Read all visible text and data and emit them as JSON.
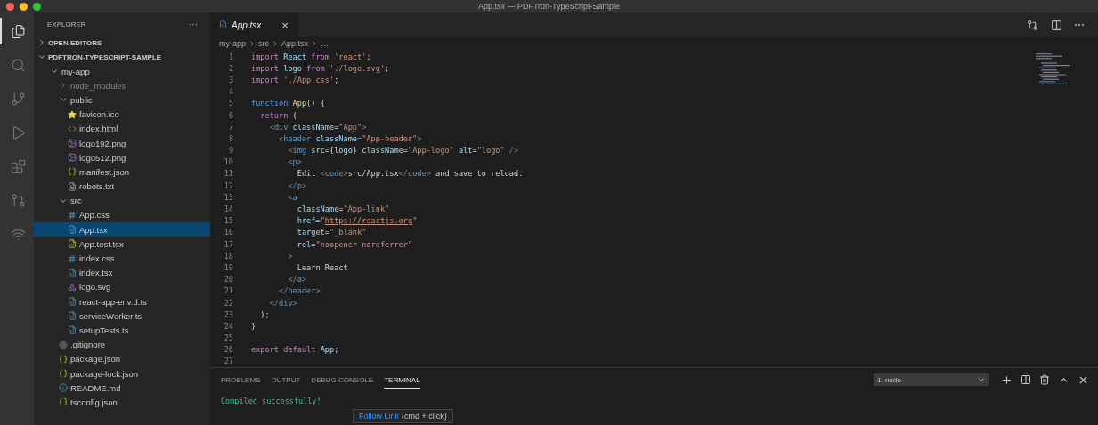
{
  "window": {
    "title": "App.tsx — PDFTron-TypeScript-Sample"
  },
  "activity_bar": [
    {
      "kind": "files",
      "selected": true
    },
    {
      "kind": "search",
      "selected": false
    },
    {
      "kind": "branch",
      "selected": false
    },
    {
      "kind": "debug",
      "selected": false
    },
    {
      "kind": "extensions",
      "selected": false
    },
    {
      "kind": "pull",
      "selected": false
    },
    {
      "kind": "remote",
      "selected": false
    }
  ],
  "sidebar": {
    "title": "EXPLORER",
    "more": "···",
    "sections": [
      {
        "label": "OPEN EDITORS",
        "expanded": false
      },
      {
        "label": "PDFTRON-TYPESCRIPT-SAMPLE",
        "expanded": true
      }
    ],
    "tree": [
      {
        "label": "my-app",
        "kind": "folder",
        "expanded": true,
        "selected": false,
        "children": [
          {
            "label": "node_modules",
            "kind": "folder",
            "expanded": false,
            "selected": false,
            "dim": true
          },
          {
            "label": "public",
            "kind": "folder",
            "expanded": true,
            "selected": false,
            "children": [
              {
                "label": "favicon.ico",
                "kind": "star",
                "selected": false
              },
              {
                "label": "index.html",
                "kind": "html",
                "selected": false
              },
              {
                "label": "logo192.png",
                "kind": "image",
                "selected": false
              },
              {
                "label": "logo512.png",
                "kind": "image",
                "selected": false
              },
              {
                "label": "manifest.json",
                "kind": "json",
                "selected": false
              },
              {
                "label": "robots.txt",
                "kind": "text",
                "selected": false
              }
            ]
          },
          {
            "label": "src",
            "kind": "folder",
            "expanded": true,
            "selected": false,
            "children": [
              {
                "label": "App.css",
                "kind": "css",
                "selected": false
              },
              {
                "label": "App.tsx",
                "kind": "ts",
                "selected": true
              },
              {
                "label": "App.test.tsx",
                "kind": "test",
                "selected": false
              },
              {
                "label": "index.css",
                "kind": "css",
                "selected": false
              },
              {
                "label": "index.tsx",
                "kind": "ts",
                "selected": false
              },
              {
                "label": "logo.svg",
                "kind": "svg",
                "selected": false
              },
              {
                "label": "react-app-env.d.ts",
                "kind": "ts",
                "selected": false
              },
              {
                "label": "serviceWorker.ts",
                "kind": "ts",
                "selected": false
              },
              {
                "label": "setupTests.ts",
                "kind": "ts",
                "selected": false
              }
            ]
          },
          {
            "label": ".gitignore",
            "kind": "git",
            "selected": false
          },
          {
            "label": "package.json",
            "kind": "json",
            "selected": false
          },
          {
            "label": "package-lock.json",
            "kind": "json",
            "selected": false
          },
          {
            "label": "README.md",
            "kind": "readme",
            "selected": false
          },
          {
            "label": "tsconfig.json",
            "kind": "json",
            "selected": false
          }
        ]
      }
    ]
  },
  "editor": {
    "tab": {
      "label": "App.tsx",
      "close": "×"
    },
    "breadcrumbs": [
      "my-app",
      "src",
      "App.tsx",
      "…"
    ],
    "lines": [
      {
        "number": "1",
        "tokens": [
          {
            "kind": "kw",
            "s": "import"
          },
          {
            "kind": "id",
            "s": " React "
          },
          {
            "kind": "kw",
            "s": "from"
          },
          {
            "kind": "str",
            "s": " 'react'"
          },
          {
            "kind": "txt",
            "s": ";"
          }
        ]
      },
      {
        "number": "2",
        "tokens": [
          {
            "kind": "kw",
            "s": "import"
          },
          {
            "kind": "id",
            "s": " logo "
          },
          {
            "kind": "kw",
            "s": "from"
          },
          {
            "kind": "str",
            "s": " './logo.svg'"
          },
          {
            "kind": "txt",
            "s": ";"
          }
        ]
      },
      {
        "number": "3",
        "tokens": [
          {
            "kind": "kw",
            "s": "import"
          },
          {
            "kind": "str",
            "s": " './App.css'"
          },
          {
            "kind": "txt",
            "s": ";"
          }
        ]
      },
      {
        "number": "4"
      },
      {
        "number": "5",
        "tokens": [
          {
            "kind": "blue",
            "s": "function"
          },
          {
            "kind": "fn",
            "s": " App"
          },
          {
            "kind": "txt",
            "s": "() {"
          }
        ]
      },
      {
        "number": "6",
        "tokens": [
          {
            "kind": "kw",
            "s": "  return"
          },
          {
            "kind": "txt",
            "s": " ("
          }
        ]
      },
      {
        "number": "7",
        "tokens": [
          {
            "kind": "punct",
            "s": "    <"
          },
          {
            "kind": "blue",
            "s": "div"
          },
          {
            "kind": "id",
            "s": " className"
          },
          {
            "kind": "txt",
            "s": "="
          },
          {
            "kind": "str",
            "s": "\"App\""
          },
          {
            "kind": "punct",
            "s": ">"
          }
        ]
      },
      {
        "number": "8",
        "tokens": [
          {
            "kind": "punct",
            "s": "      <"
          },
          {
            "kind": "blue",
            "s": "header"
          },
          {
            "kind": "id",
            "s": " className"
          },
          {
            "kind": "txt",
            "s": "="
          },
          {
            "kind": "str",
            "s": "\"App-header\""
          },
          {
            "kind": "punct",
            "s": ">"
          }
        ]
      },
      {
        "number": "9",
        "tokens": [
          {
            "kind": "punct",
            "s": "        <"
          },
          {
            "kind": "blue",
            "s": "img"
          },
          {
            "kind": "id",
            "s": " src"
          },
          {
            "kind": "txt",
            "s": "={"
          },
          {
            "kind": "id",
            "s": "logo"
          },
          {
            "kind": "txt",
            "s": "}"
          },
          {
            "kind": "id",
            "s": " className"
          },
          {
            "kind": "txt",
            "s": "="
          },
          {
            "kind": "str",
            "s": "\"App-logo\""
          },
          {
            "kind": "id",
            "s": " alt"
          },
          {
            "kind": "txt",
            "s": "="
          },
          {
            "kind": "str",
            "s": "\"logo\""
          },
          {
            "kind": "punct",
            "s": " />"
          }
        ]
      },
      {
        "number": "10",
        "tokens": [
          {
            "kind": "punct",
            "s": "        <"
          },
          {
            "kind": "blue",
            "s": "p"
          },
          {
            "kind": "punct",
            "s": ">"
          }
        ]
      },
      {
        "number": "11",
        "tokens": [
          {
            "kind": "txt",
            "s": "          Edit "
          },
          {
            "kind": "punct",
            "s": "<"
          },
          {
            "kind": "blue",
            "s": "code"
          },
          {
            "kind": "punct",
            "s": ">"
          },
          {
            "kind": "txt",
            "s": "src/App.tsx"
          },
          {
            "kind": "punct",
            "s": "</"
          },
          {
            "kind": "blue",
            "s": "code"
          },
          {
            "kind": "punct",
            "s": ">"
          },
          {
            "kind": "txt",
            "s": " and save to reload."
          }
        ]
      },
      {
        "number": "12",
        "tokens": [
          {
            "kind": "punct",
            "s": "        </"
          },
          {
            "kind": "blue",
            "s": "p"
          },
          {
            "kind": "punct",
            "s": ">"
          }
        ]
      },
      {
        "number": "13",
        "tokens": [
          {
            "kind": "punct",
            "s": "        <"
          },
          {
            "kind": "blue",
            "s": "a"
          }
        ]
      },
      {
        "number": "14",
        "tokens": [
          {
            "kind": "id",
            "s": "          className"
          },
          {
            "kind": "txt",
            "s": "="
          },
          {
            "kind": "str",
            "s": "\"App-link\""
          }
        ]
      },
      {
        "number": "15",
        "tokens": [
          {
            "kind": "id",
            "s": "          href"
          },
          {
            "kind": "txt",
            "s": "="
          },
          {
            "kind": "str",
            "s": "\""
          },
          {
            "kind": "link",
            "s": "https://reactjs.org"
          },
          {
            "kind": "str",
            "s": "\""
          }
        ]
      },
      {
        "number": "16",
        "tokens": [
          {
            "kind": "id",
            "s": "          target"
          },
          {
            "kind": "txt",
            "s": "="
          },
          {
            "kind": "str",
            "s": "\"_blank\""
          }
        ]
      },
      {
        "number": "17",
        "tokens": [
          {
            "kind": "id",
            "s": "          rel"
          },
          {
            "kind": "txt",
            "s": "="
          },
          {
            "kind": "str",
            "s": "\"noopener noreferrer\""
          }
        ]
      },
      {
        "number": "18",
        "tokens": [
          {
            "kind": "punct",
            "s": "        >"
          }
        ]
      },
      {
        "number": "19",
        "tokens": [
          {
            "kind": "txt",
            "s": "          Learn React"
          }
        ]
      },
      {
        "number": "20",
        "tokens": [
          {
            "kind": "punct",
            "s": "        </"
          },
          {
            "kind": "blue",
            "s": "a"
          },
          {
            "kind": "punct",
            "s": ">"
          }
        ]
      },
      {
        "number": "21",
        "tokens": [
          {
            "kind": "punct",
            "s": "      </"
          },
          {
            "kind": "blue",
            "s": "header"
          },
          {
            "kind": "punct",
            "s": ">"
          }
        ]
      },
      {
        "number": "22",
        "tokens": [
          {
            "kind": "punct",
            "s": "    </"
          },
          {
            "kind": "blue",
            "s": "div"
          },
          {
            "kind": "punct",
            "s": ">"
          }
        ]
      },
      {
        "number": "23",
        "tokens": [
          {
            "kind": "txt",
            "s": "  );"
          }
        ]
      },
      {
        "number": "24",
        "tokens": [
          {
            "kind": "txt",
            "s": "}"
          }
        ]
      },
      {
        "number": "25"
      },
      {
        "number": "26",
        "tokens": [
          {
            "kind": "kw",
            "s": "export"
          },
          {
            "kind": "kw",
            "s": " default"
          },
          {
            "kind": "id",
            "s": " App"
          },
          {
            "kind": "txt",
            "s": ";"
          }
        ]
      },
      {
        "number": "27"
      }
    ]
  },
  "panel": {
    "tabs": [
      {
        "label": "PROBLEMS",
        "selected": false
      },
      {
        "label": "OUTPUT",
        "selected": false
      },
      {
        "label": "DEBUG CONSOLE",
        "selected": false
      },
      {
        "label": "TERMINAL",
        "selected": true
      }
    ],
    "terminal_select": "1: node",
    "terminal_lines": [
      "Compiled successfully!"
    ],
    "tooltip": {
      "link": "Follow Link",
      "hint": "(cmd + click)"
    }
  }
}
